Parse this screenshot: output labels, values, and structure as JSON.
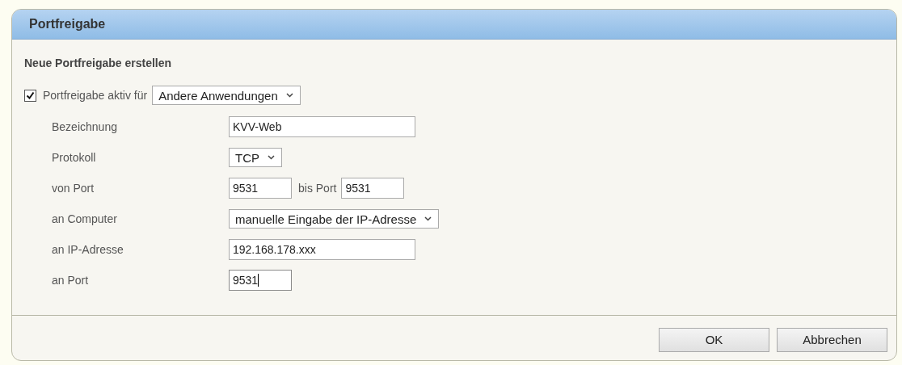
{
  "window": {
    "title": "Portfreigabe"
  },
  "section_title": "Neue Portfreigabe erstellen",
  "enable": {
    "checked": true,
    "label": "Portfreigabe aktiv für",
    "select": "Andere Anwendungen"
  },
  "fields": [
    {
      "label": "Bezeichnung",
      "kind": "text",
      "value": "KVV-Web",
      "focused": false
    },
    {
      "label": "Protokoll",
      "kind": "select",
      "value": "TCP"
    },
    {
      "label": "von Port",
      "kind": "range",
      "value": "9531",
      "between": "bis Port",
      "value2": "9531"
    },
    {
      "label": "an Computer",
      "kind": "select",
      "value": "manuelle Eingabe der IP-Adresse"
    },
    {
      "label": "an IP-Adresse",
      "kind": "text",
      "value": "192.168.178.xxx",
      "focused": false
    },
    {
      "label": "an Port",
      "kind": "number",
      "value": "9531",
      "focused": true
    }
  ],
  "buttons": [
    "OK",
    "Abbrechen"
  ]
}
